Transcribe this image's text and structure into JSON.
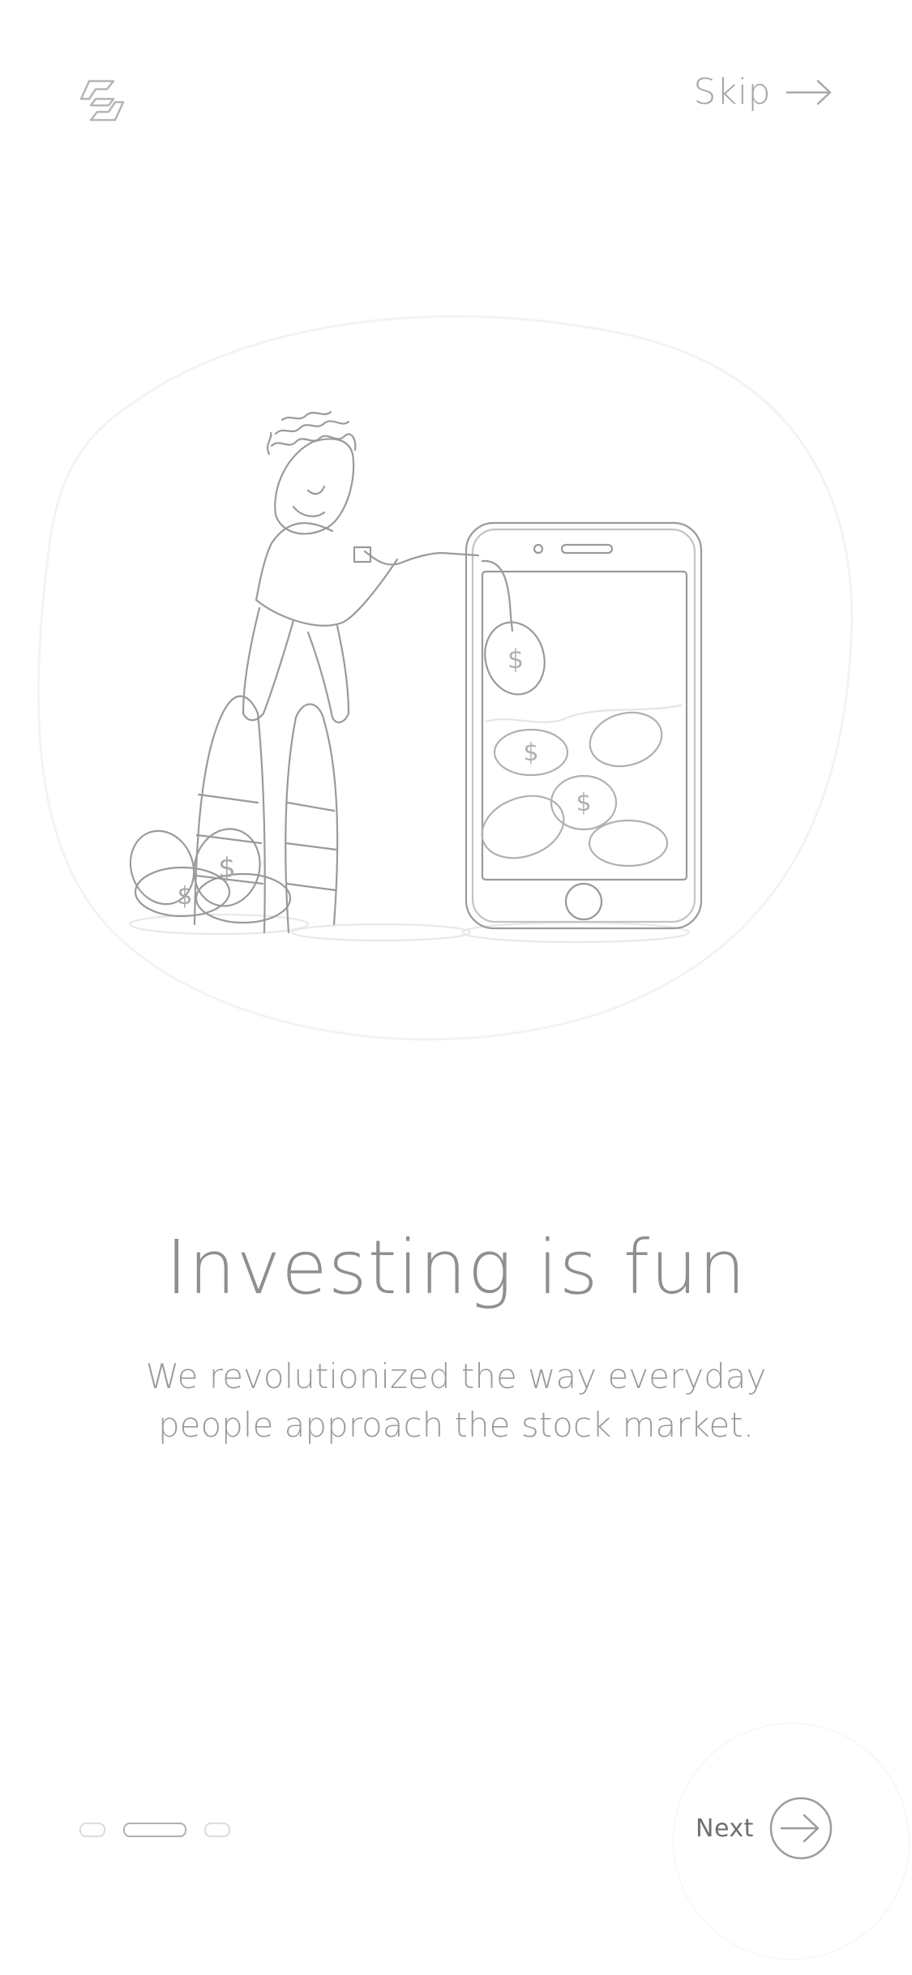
{
  "header": {
    "skip_label": "Skip",
    "logo_icon": "brand-logo-icon",
    "skip_icon": "arrow-right-icon"
  },
  "illustration": {
    "description_icon": "person-phone-coins-illustration",
    "coin_symbol": "$"
  },
  "content": {
    "title": "Investing is fun",
    "subtitle": "We revolutionized the way everyday people approach the stock market."
  },
  "pagination": {
    "total": 3,
    "active_index": 2
  },
  "footer": {
    "next_label": "Next",
    "next_icon": "arrow-right-circle-icon"
  },
  "colors": {
    "background": "#ffffff",
    "line": "#9a9a9a",
    "text": "#8f8f8f"
  }
}
